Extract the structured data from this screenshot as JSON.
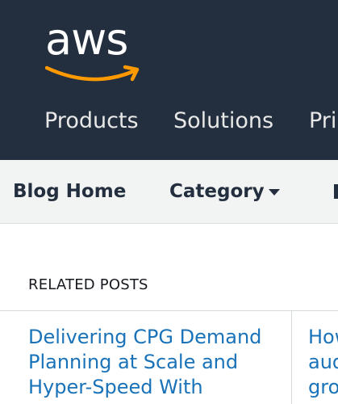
{
  "header": {
    "logo_text": "aws",
    "logo_icon": "amazon-smile-arrow",
    "nav": [
      "Products",
      "Solutions",
      "Pri"
    ]
  },
  "subnav": {
    "blog_home": "Blog Home",
    "category": "Category"
  },
  "related": {
    "heading": "RELATED POSTS",
    "posts": [
      {
        "title": "Delivering CPG Demand Planning at Scale and Hyper-Speed With"
      },
      {
        "title": "How\naud\ngro"
      }
    ]
  },
  "colors": {
    "header_bg": "#232f3e",
    "logo_orange": "#ff9900",
    "subnav_bg": "#f2f3f3",
    "link_blue": "#1a73b8"
  }
}
